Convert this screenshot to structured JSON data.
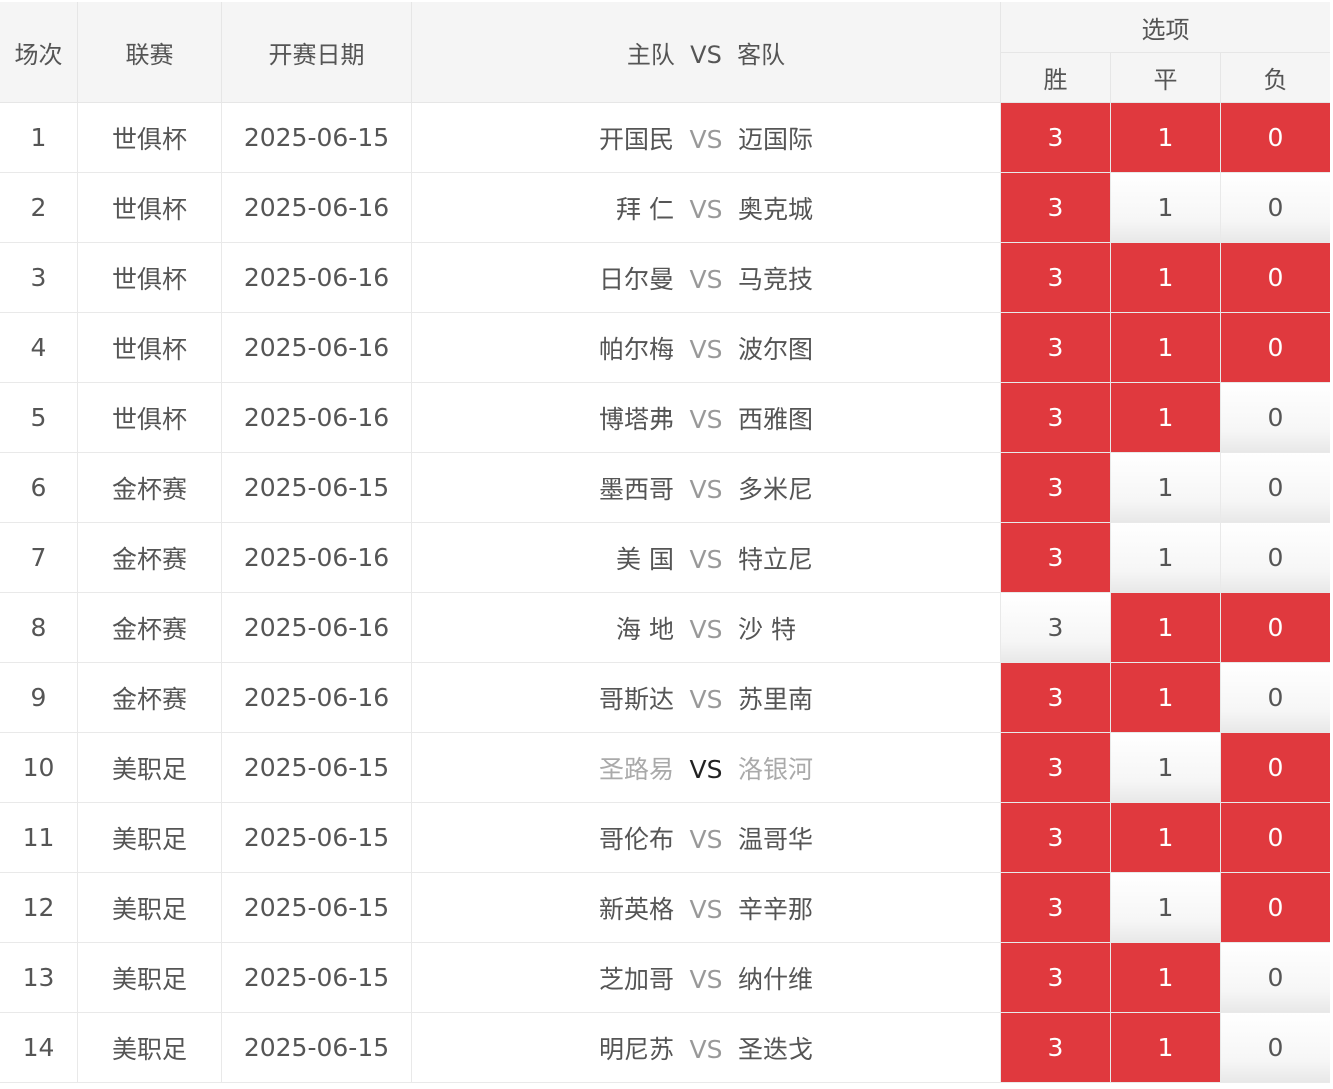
{
  "header": {
    "round": "场次",
    "league": "联赛",
    "date": "开赛日期",
    "matchup": "主队  VS  客队",
    "options": "选项",
    "win": "胜",
    "draw": "平",
    "lose": "负"
  },
  "colors": {
    "selected": "#e0393e",
    "header_bg": "#f5f5f5"
  },
  "rows": [
    {
      "num": "1",
      "league": "世俱杯",
      "date": "2025-06-15",
      "home": "开国民",
      "vs": "VS",
      "away": "迈国际",
      "win": "3",
      "draw": "1",
      "lose": "0",
      "sel": [
        true,
        true,
        true
      ]
    },
    {
      "num": "2",
      "league": "世俱杯",
      "date": "2025-06-16",
      "home": "拜 仁",
      "vs": "VS",
      "away": "奥克城",
      "win": "3",
      "draw": "1",
      "lose": "0",
      "sel": [
        true,
        false,
        false
      ]
    },
    {
      "num": "3",
      "league": "世俱杯",
      "date": "2025-06-16",
      "home": "日尔曼",
      "vs": "VS",
      "away": "马竞技",
      "win": "3",
      "draw": "1",
      "lose": "0",
      "sel": [
        true,
        true,
        true
      ]
    },
    {
      "num": "4",
      "league": "世俱杯",
      "date": "2025-06-16",
      "home": "帕尔梅",
      "vs": "VS",
      "away": "波尔图",
      "win": "3",
      "draw": "1",
      "lose": "0",
      "sel": [
        true,
        true,
        true
      ]
    },
    {
      "num": "5",
      "league": "世俱杯",
      "date": "2025-06-16",
      "home": "博塔弗",
      "vs": "VS",
      "away": "西雅图",
      "win": "3",
      "draw": "1",
      "lose": "0",
      "sel": [
        true,
        true,
        false
      ]
    },
    {
      "num": "6",
      "league": "金杯赛",
      "date": "2025-06-15",
      "home": "墨西哥",
      "vs": "VS",
      "away": "多米尼",
      "win": "3",
      "draw": "1",
      "lose": "0",
      "sel": [
        true,
        false,
        false
      ]
    },
    {
      "num": "7",
      "league": "金杯赛",
      "date": "2025-06-16",
      "home": "美 国",
      "vs": "VS",
      "away": "特立尼",
      "win": "3",
      "draw": "1",
      "lose": "0",
      "sel": [
        true,
        false,
        false
      ]
    },
    {
      "num": "8",
      "league": "金杯赛",
      "date": "2025-06-16",
      "home": "海 地",
      "vs": "VS",
      "away": "沙 特",
      "win": "3",
      "draw": "1",
      "lose": "0",
      "sel": [
        false,
        true,
        true
      ]
    },
    {
      "num": "9",
      "league": "金杯赛",
      "date": "2025-06-16",
      "home": "哥斯达",
      "vs": "VS",
      "away": "苏里南",
      "win": "3",
      "draw": "1",
      "lose": "0",
      "sel": [
        true,
        true,
        false
      ]
    },
    {
      "num": "10",
      "league": "美职足",
      "date": "2025-06-15",
      "home": "圣路易",
      "vs": "VS",
      "away": "洛银河",
      "win": "3",
      "draw": "1",
      "lose": "0",
      "sel": [
        true,
        false,
        true
      ],
      "dim": true
    },
    {
      "num": "11",
      "league": "美职足",
      "date": "2025-06-15",
      "home": "哥伦布",
      "vs": "VS",
      "away": "温哥华",
      "win": "3",
      "draw": "1",
      "lose": "0",
      "sel": [
        true,
        true,
        true
      ]
    },
    {
      "num": "12",
      "league": "美职足",
      "date": "2025-06-15",
      "home": "新英格",
      "vs": "VS",
      "away": "辛辛那",
      "win": "3",
      "draw": "1",
      "lose": "0",
      "sel": [
        true,
        false,
        true
      ]
    },
    {
      "num": "13",
      "league": "美职足",
      "date": "2025-06-15",
      "home": "芝加哥",
      "vs": "VS",
      "away": "纳什维",
      "win": "3",
      "draw": "1",
      "lose": "0",
      "sel": [
        true,
        true,
        false
      ]
    },
    {
      "num": "14",
      "league": "美职足",
      "date": "2025-06-15",
      "home": "明尼苏",
      "vs": "VS",
      "away": "圣迭戈",
      "win": "3",
      "draw": "1",
      "lose": "0",
      "sel": [
        true,
        true,
        false
      ]
    }
  ]
}
